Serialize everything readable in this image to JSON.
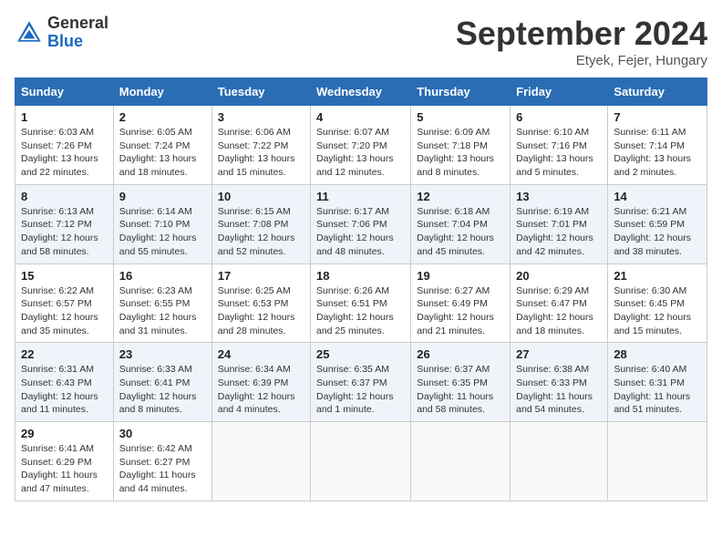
{
  "header": {
    "logo_general": "General",
    "logo_blue": "Blue",
    "month_title": "September 2024",
    "location": "Etyek, Fejer, Hungary"
  },
  "columns": [
    "Sunday",
    "Monday",
    "Tuesday",
    "Wednesday",
    "Thursday",
    "Friday",
    "Saturday"
  ],
  "weeks": [
    [
      {
        "day": "1",
        "sunrise": "Sunrise: 6:03 AM",
        "sunset": "Sunset: 7:26 PM",
        "daylight": "Daylight: 13 hours and 22 minutes."
      },
      {
        "day": "2",
        "sunrise": "Sunrise: 6:05 AM",
        "sunset": "Sunset: 7:24 PM",
        "daylight": "Daylight: 13 hours and 18 minutes."
      },
      {
        "day": "3",
        "sunrise": "Sunrise: 6:06 AM",
        "sunset": "Sunset: 7:22 PM",
        "daylight": "Daylight: 13 hours and 15 minutes."
      },
      {
        "day": "4",
        "sunrise": "Sunrise: 6:07 AM",
        "sunset": "Sunset: 7:20 PM",
        "daylight": "Daylight: 13 hours and 12 minutes."
      },
      {
        "day": "5",
        "sunrise": "Sunrise: 6:09 AM",
        "sunset": "Sunset: 7:18 PM",
        "daylight": "Daylight: 13 hours and 8 minutes."
      },
      {
        "day": "6",
        "sunrise": "Sunrise: 6:10 AM",
        "sunset": "Sunset: 7:16 PM",
        "daylight": "Daylight: 13 hours and 5 minutes."
      },
      {
        "day": "7",
        "sunrise": "Sunrise: 6:11 AM",
        "sunset": "Sunset: 7:14 PM",
        "daylight": "Daylight: 13 hours and 2 minutes."
      }
    ],
    [
      {
        "day": "8",
        "sunrise": "Sunrise: 6:13 AM",
        "sunset": "Sunset: 7:12 PM",
        "daylight": "Daylight: 12 hours and 58 minutes."
      },
      {
        "day": "9",
        "sunrise": "Sunrise: 6:14 AM",
        "sunset": "Sunset: 7:10 PM",
        "daylight": "Daylight: 12 hours and 55 minutes."
      },
      {
        "day": "10",
        "sunrise": "Sunrise: 6:15 AM",
        "sunset": "Sunset: 7:08 PM",
        "daylight": "Daylight: 12 hours and 52 minutes."
      },
      {
        "day": "11",
        "sunrise": "Sunrise: 6:17 AM",
        "sunset": "Sunset: 7:06 PM",
        "daylight": "Daylight: 12 hours and 48 minutes."
      },
      {
        "day": "12",
        "sunrise": "Sunrise: 6:18 AM",
        "sunset": "Sunset: 7:04 PM",
        "daylight": "Daylight: 12 hours and 45 minutes."
      },
      {
        "day": "13",
        "sunrise": "Sunrise: 6:19 AM",
        "sunset": "Sunset: 7:01 PM",
        "daylight": "Daylight: 12 hours and 42 minutes."
      },
      {
        "day": "14",
        "sunrise": "Sunrise: 6:21 AM",
        "sunset": "Sunset: 6:59 PM",
        "daylight": "Daylight: 12 hours and 38 minutes."
      }
    ],
    [
      {
        "day": "15",
        "sunrise": "Sunrise: 6:22 AM",
        "sunset": "Sunset: 6:57 PM",
        "daylight": "Daylight: 12 hours and 35 minutes."
      },
      {
        "day": "16",
        "sunrise": "Sunrise: 6:23 AM",
        "sunset": "Sunset: 6:55 PM",
        "daylight": "Daylight: 12 hours and 31 minutes."
      },
      {
        "day": "17",
        "sunrise": "Sunrise: 6:25 AM",
        "sunset": "Sunset: 6:53 PM",
        "daylight": "Daylight: 12 hours and 28 minutes."
      },
      {
        "day": "18",
        "sunrise": "Sunrise: 6:26 AM",
        "sunset": "Sunset: 6:51 PM",
        "daylight": "Daylight: 12 hours and 25 minutes."
      },
      {
        "day": "19",
        "sunrise": "Sunrise: 6:27 AM",
        "sunset": "Sunset: 6:49 PM",
        "daylight": "Daylight: 12 hours and 21 minutes."
      },
      {
        "day": "20",
        "sunrise": "Sunrise: 6:29 AM",
        "sunset": "Sunset: 6:47 PM",
        "daylight": "Daylight: 12 hours and 18 minutes."
      },
      {
        "day": "21",
        "sunrise": "Sunrise: 6:30 AM",
        "sunset": "Sunset: 6:45 PM",
        "daylight": "Daylight: 12 hours and 15 minutes."
      }
    ],
    [
      {
        "day": "22",
        "sunrise": "Sunrise: 6:31 AM",
        "sunset": "Sunset: 6:43 PM",
        "daylight": "Daylight: 12 hours and 11 minutes."
      },
      {
        "day": "23",
        "sunrise": "Sunrise: 6:33 AM",
        "sunset": "Sunset: 6:41 PM",
        "daylight": "Daylight: 12 hours and 8 minutes."
      },
      {
        "day": "24",
        "sunrise": "Sunrise: 6:34 AM",
        "sunset": "Sunset: 6:39 PM",
        "daylight": "Daylight: 12 hours and 4 minutes."
      },
      {
        "day": "25",
        "sunrise": "Sunrise: 6:35 AM",
        "sunset": "Sunset: 6:37 PM",
        "daylight": "Daylight: 12 hours and 1 minute."
      },
      {
        "day": "26",
        "sunrise": "Sunrise: 6:37 AM",
        "sunset": "Sunset: 6:35 PM",
        "daylight": "Daylight: 11 hours and 58 minutes."
      },
      {
        "day": "27",
        "sunrise": "Sunrise: 6:38 AM",
        "sunset": "Sunset: 6:33 PM",
        "daylight": "Daylight: 11 hours and 54 minutes."
      },
      {
        "day": "28",
        "sunrise": "Sunrise: 6:40 AM",
        "sunset": "Sunset: 6:31 PM",
        "daylight": "Daylight: 11 hours and 51 minutes."
      }
    ],
    [
      {
        "day": "29",
        "sunrise": "Sunrise: 6:41 AM",
        "sunset": "Sunset: 6:29 PM",
        "daylight": "Daylight: 11 hours and 47 minutes."
      },
      {
        "day": "30",
        "sunrise": "Sunrise: 6:42 AM",
        "sunset": "Sunset: 6:27 PM",
        "daylight": "Daylight: 11 hours and 44 minutes."
      },
      null,
      null,
      null,
      null,
      null
    ]
  ]
}
